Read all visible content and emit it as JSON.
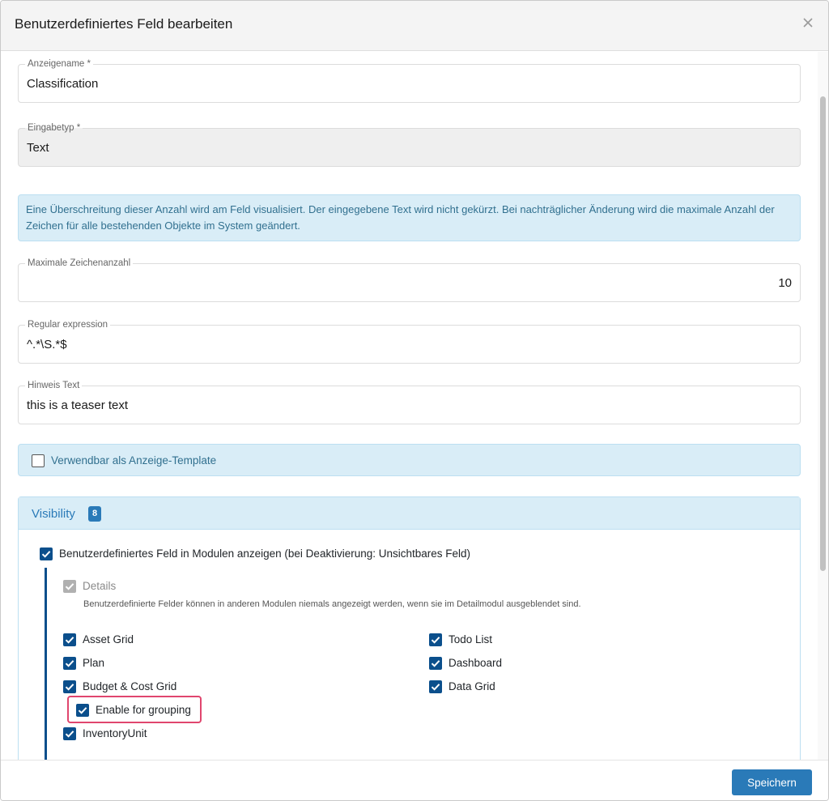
{
  "dialog": {
    "title": "Benutzerdefiniertes Feld bearbeiten",
    "save_label": "Speichern"
  },
  "fields": {
    "display_name": {
      "label": "Anzeigename *",
      "value": "Classification"
    },
    "input_type": {
      "label": "Eingabetyp *",
      "value": "Text"
    },
    "max_chars": {
      "label": "Maximale Zeichenanzahl",
      "value": "10"
    },
    "regex": {
      "label": "Regular expression",
      "value": "^.*\\S.*$"
    },
    "hint": {
      "label": "Hinweis Text",
      "value": "this is a teaser text"
    }
  },
  "info_text": "Eine Überschreitung dieser Anzahl wird am Feld visualisiert. Der eingegebene Text wird nicht gekürzt. Bei nachträglicher Änderung wird die maximale Anzahl der Zeichen für alle bestehenden Objekte im System geändert.",
  "template_option": {
    "label": "Verwendbar als Anzeige-Template",
    "checked": false
  },
  "visibility": {
    "title": "Visibility",
    "badge": "8",
    "show_in_modules": {
      "label": "Benutzerdefiniertes Feld in Modulen anzeigen (bei Deaktivierung: Unsichtbares Feld)",
      "checked": true
    },
    "details": {
      "label": "Details",
      "checked": true,
      "disabled": true
    },
    "details_note": "Benutzerdefinierte Felder können in anderen Modulen niemals angezeigt werden, wenn sie im Detailmodul ausgeblendet sind.",
    "modules_left": [
      {
        "label": "Asset Grid",
        "checked": true
      },
      {
        "label": "Plan",
        "checked": true
      },
      {
        "label": "Budget & Cost Grid",
        "checked": true
      }
    ],
    "modules_right": [
      {
        "label": "Todo List",
        "checked": true
      },
      {
        "label": "Dashboard",
        "checked": true
      },
      {
        "label": "Data Grid",
        "checked": true
      }
    ],
    "grouping": {
      "label": "Enable for grouping",
      "checked": true
    },
    "inventory": {
      "label": "InventoryUnit",
      "checked": true
    }
  },
  "colors": {
    "primary": "#2a7ab8",
    "checkbox": "#0b4f8c",
    "info_bg": "#d9edf7",
    "highlight": "#e0466e"
  }
}
